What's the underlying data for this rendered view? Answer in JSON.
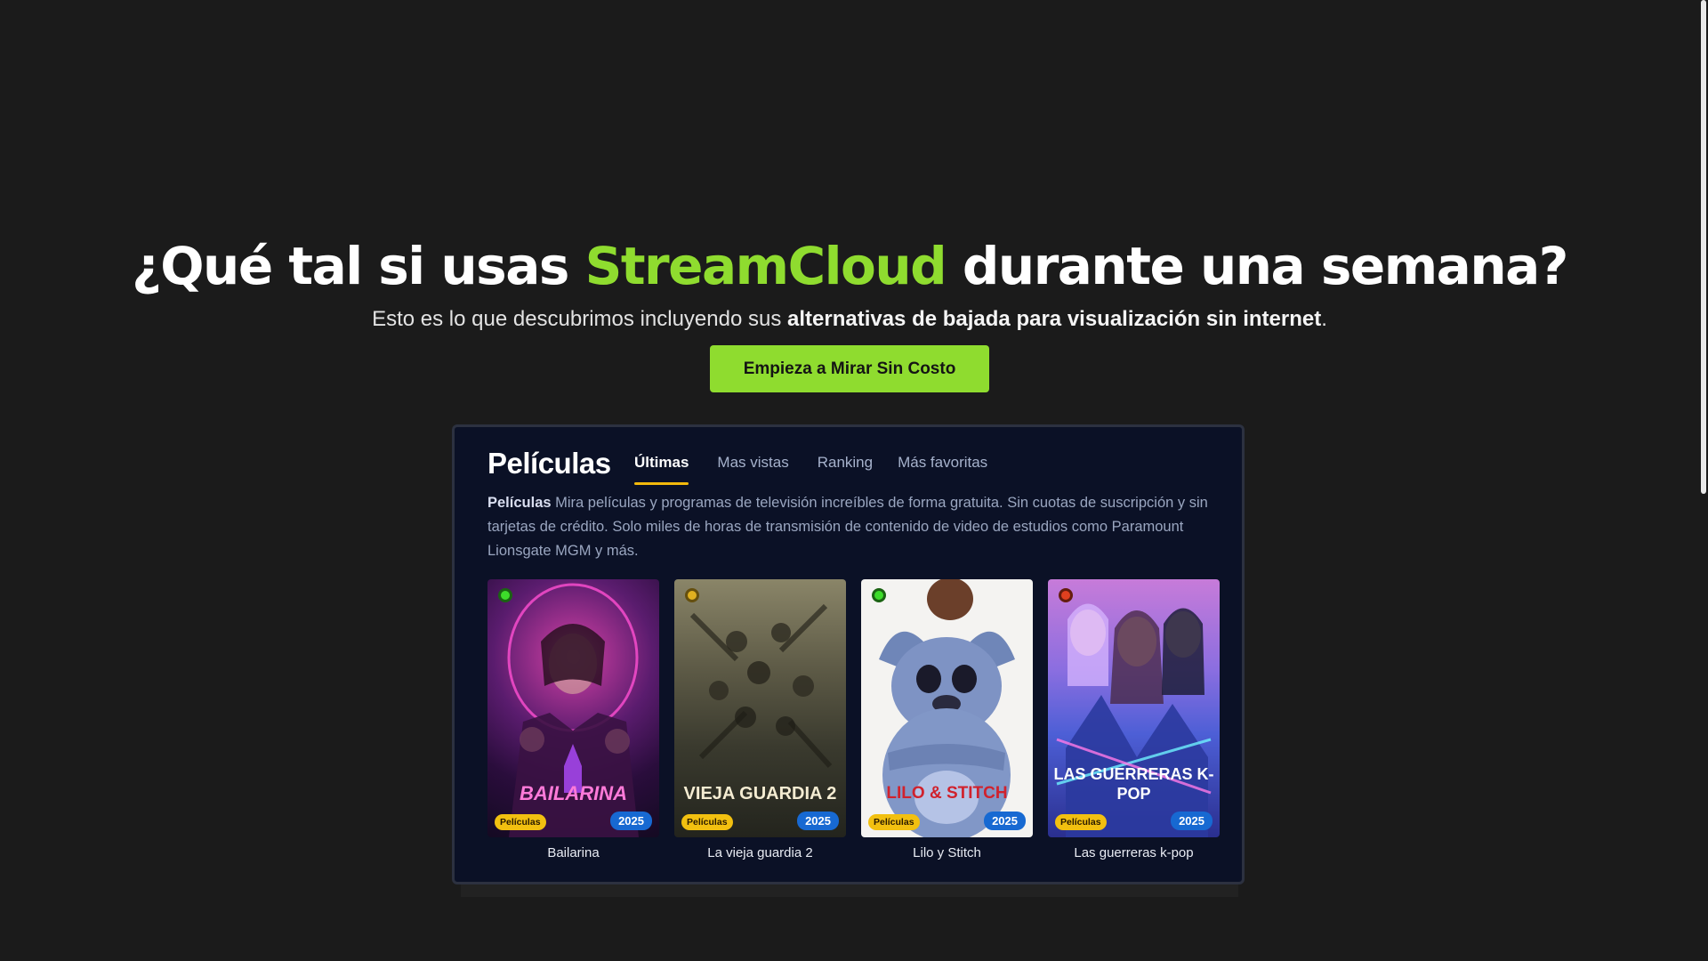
{
  "hero": {
    "title_before": "¿Qué tal si usas ",
    "title_brand": "StreamCloud",
    "title_after": " durante una semana?",
    "subtitle_before": "Esto es lo que descubrimos incluyendo sus ",
    "subtitle_bold": "alternativas de bajada para visualización sin internet",
    "subtitle_after": ".",
    "cta_label": "Empieza a Mirar Sin Costo"
  },
  "colors": {
    "background": "#1b1b1b",
    "brand_green": "#8fdc2f",
    "card_background": "#0b1126",
    "tab_underline": "#f2b90c",
    "category_badge": "#f2c010",
    "year_badge": "#1769d2"
  },
  "preview": {
    "title": "Películas",
    "tabs": [
      {
        "label": "Últimas",
        "active": true
      },
      {
        "label": "Mas vistas",
        "active": false
      },
      {
        "label": "Ranking",
        "active": false
      },
      {
        "label": "Más favoritas",
        "active": false
      }
    ],
    "description_bold": "Películas",
    "description": " Mira películas y programas de televisión increíbles de forma gratuita. Sin cuotas de suscripción y sin tarjetas de crédito. Solo miles de horas de transmisión de contenido de video de estudios como Paramount Lionsgate MGM y más.",
    "movies": [
      {
        "title": "Bailarina",
        "poster_text": "BAILARINA",
        "category": "Películas",
        "year": "2025",
        "status_color": "#3ddc2a"
      },
      {
        "title": "La vieja guardia 2",
        "poster_text": "VIEJA GUARDIA 2",
        "category": "Películas",
        "year": "2025",
        "status_color": "#e0b020"
      },
      {
        "title": "Lilo y Stitch",
        "poster_text": "LILO & STITCH",
        "category": "Películas",
        "year": "2025",
        "status_color": "#3ddc2a"
      },
      {
        "title": "Las guerreras k-pop",
        "poster_text": "LAS GUERRERAS K-POP",
        "category": "Películas",
        "year": "2025",
        "status_color": "#e0401f"
      }
    ]
  }
}
